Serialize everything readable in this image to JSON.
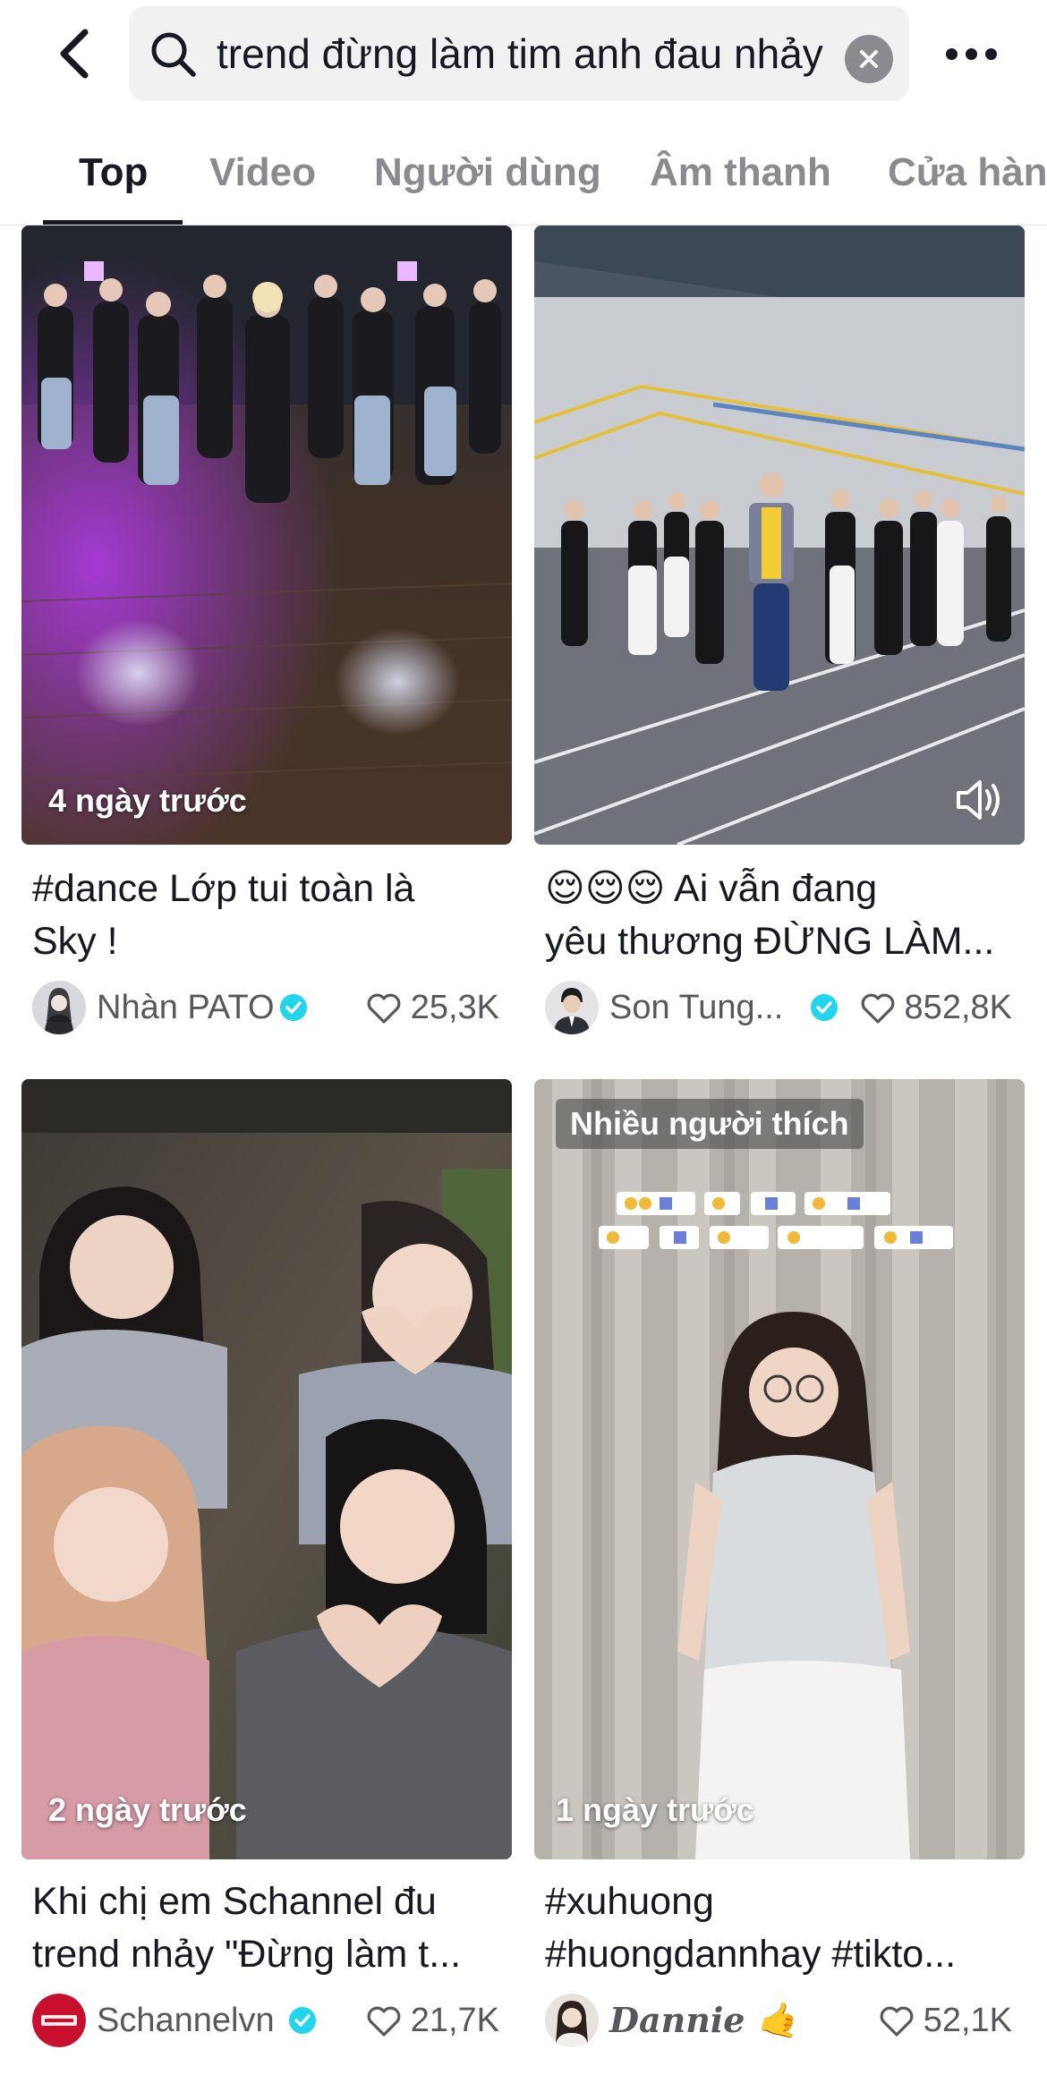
{
  "header": {
    "search_query": "trend đừng làm tim anh đau nhảy"
  },
  "tabs": [
    {
      "label": "Top",
      "active": true
    },
    {
      "label": "Video",
      "active": false
    },
    {
      "label": "Người dùng",
      "active": false
    },
    {
      "label": "Âm thanh",
      "active": false
    },
    {
      "label": "Cửa hàng",
      "active": false
    }
  ],
  "videos": [
    {
      "overlay": "4 ngày trước",
      "caption_line1": "#dance Lớp tui toàn là",
      "caption_line2": "Sky !",
      "author": "Nhàn PATO",
      "verified": true,
      "likes": "25,3K"
    },
    {
      "overlay_icon": "sound-on-icon",
      "caption_line1": "😌😌😌 Ai vẫn đang",
      "caption_line2": "yêu thương ĐỪNG LÀM...",
      "author": "Son Tung...",
      "verified": true,
      "likes": "852,8K"
    },
    {
      "overlay": "2 ngày trước",
      "caption_line1": "Khi chị em Schannel đu",
      "caption_line2": "trend nhảy \"Đừng làm t...",
      "author": "Schannelvn",
      "verified": true,
      "likes": "21,7K"
    },
    {
      "badge": "Nhiều người thích",
      "overlay": "1 ngày trước",
      "caption_line1": "#xuhuong",
      "caption_line2": "#huongdannhay #tikto...",
      "author": "𝑫𝒂𝒏𝒏𝒊𝒆 🤙",
      "verified": false,
      "likes": "52,1K"
    }
  ],
  "colors": {
    "accent_verified": "#20d5ec",
    "text_primary": "#161823",
    "text_secondary": "#8a8b91"
  }
}
